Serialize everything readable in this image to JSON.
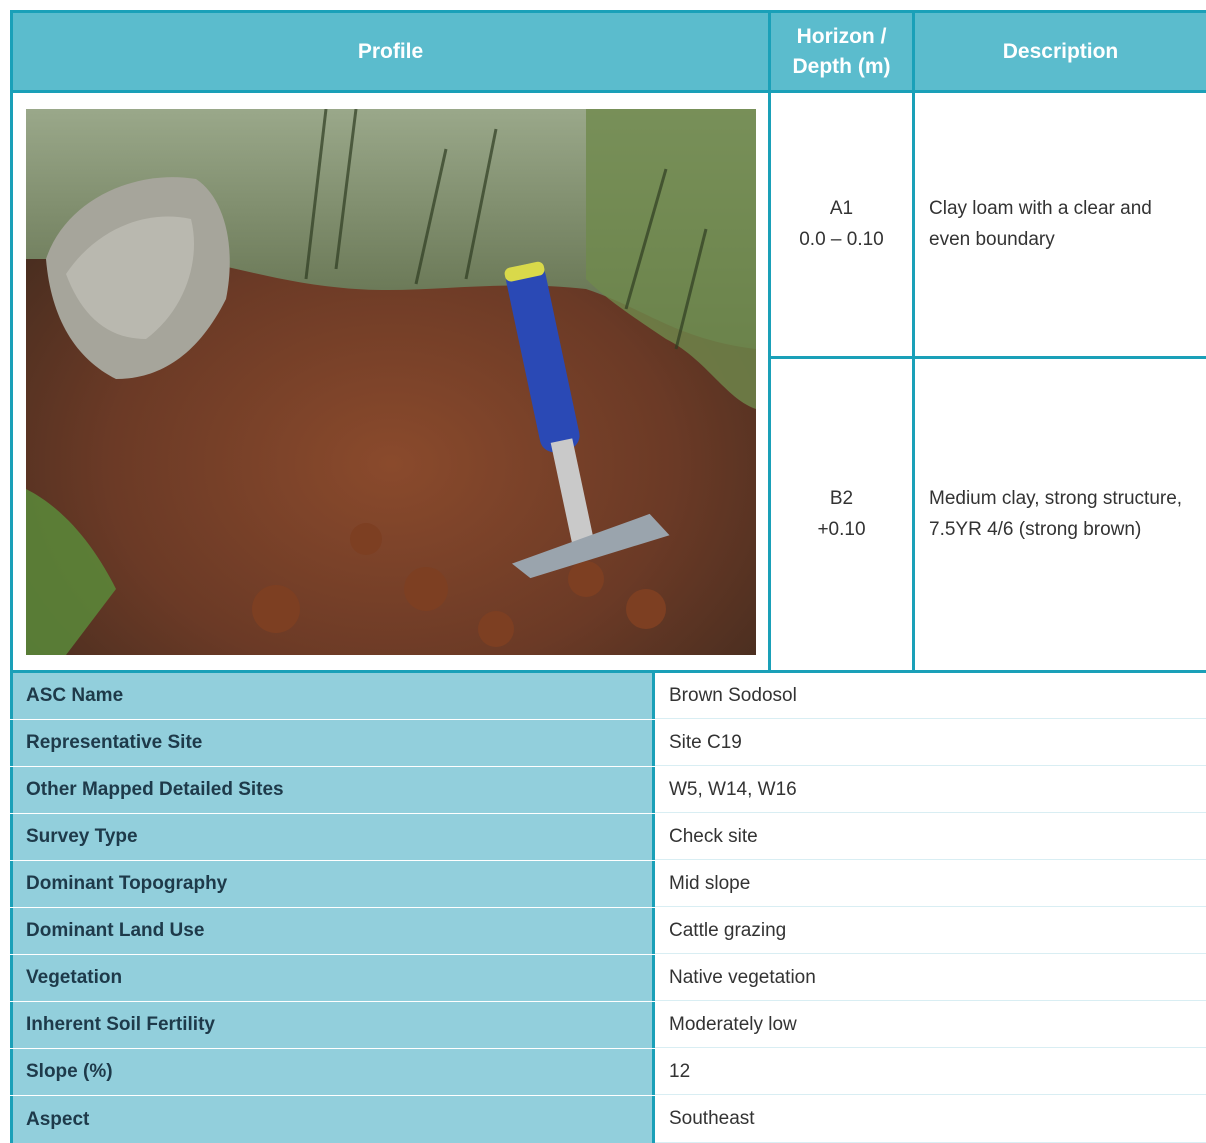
{
  "header": {
    "profile": "Profile",
    "horizon_line1": "Horizon /",
    "horizon_line2": "Depth (m)",
    "description": "Description"
  },
  "horizons": [
    {
      "name": "A1",
      "depth": "0.0 – 0.10",
      "description": "Clay loam with a clear and even boundary"
    },
    {
      "name": "B2",
      "depth": "+0.10",
      "description": "Medium clay, strong structure, 7.5YR 4/6 (strong brown)"
    }
  ],
  "properties": [
    {
      "label": "ASC Name",
      "value": "Brown Sodosol"
    },
    {
      "label": "Representative Site",
      "value": "Site C19"
    },
    {
      "label": "Other Mapped Detailed Sites",
      "value": "W5, W14, W16"
    },
    {
      "label": "Survey Type",
      "value": "Check site"
    },
    {
      "label": "Dominant Topography",
      "value": "Mid slope"
    },
    {
      "label": "Dominant Land Use",
      "value": "Cattle grazing"
    },
    {
      "label": "Vegetation",
      "value": "Native vegetation"
    },
    {
      "label": "Inherent Soil Fertility",
      "value": "Moderately low"
    },
    {
      "label": "Slope (%)",
      "value": "12"
    },
    {
      "label": "Aspect",
      "value": "Southeast"
    }
  ],
  "colors": {
    "header_bg": "#5bbccd",
    "border": "#1aa0b8",
    "label_bg": "#92cfdc"
  }
}
